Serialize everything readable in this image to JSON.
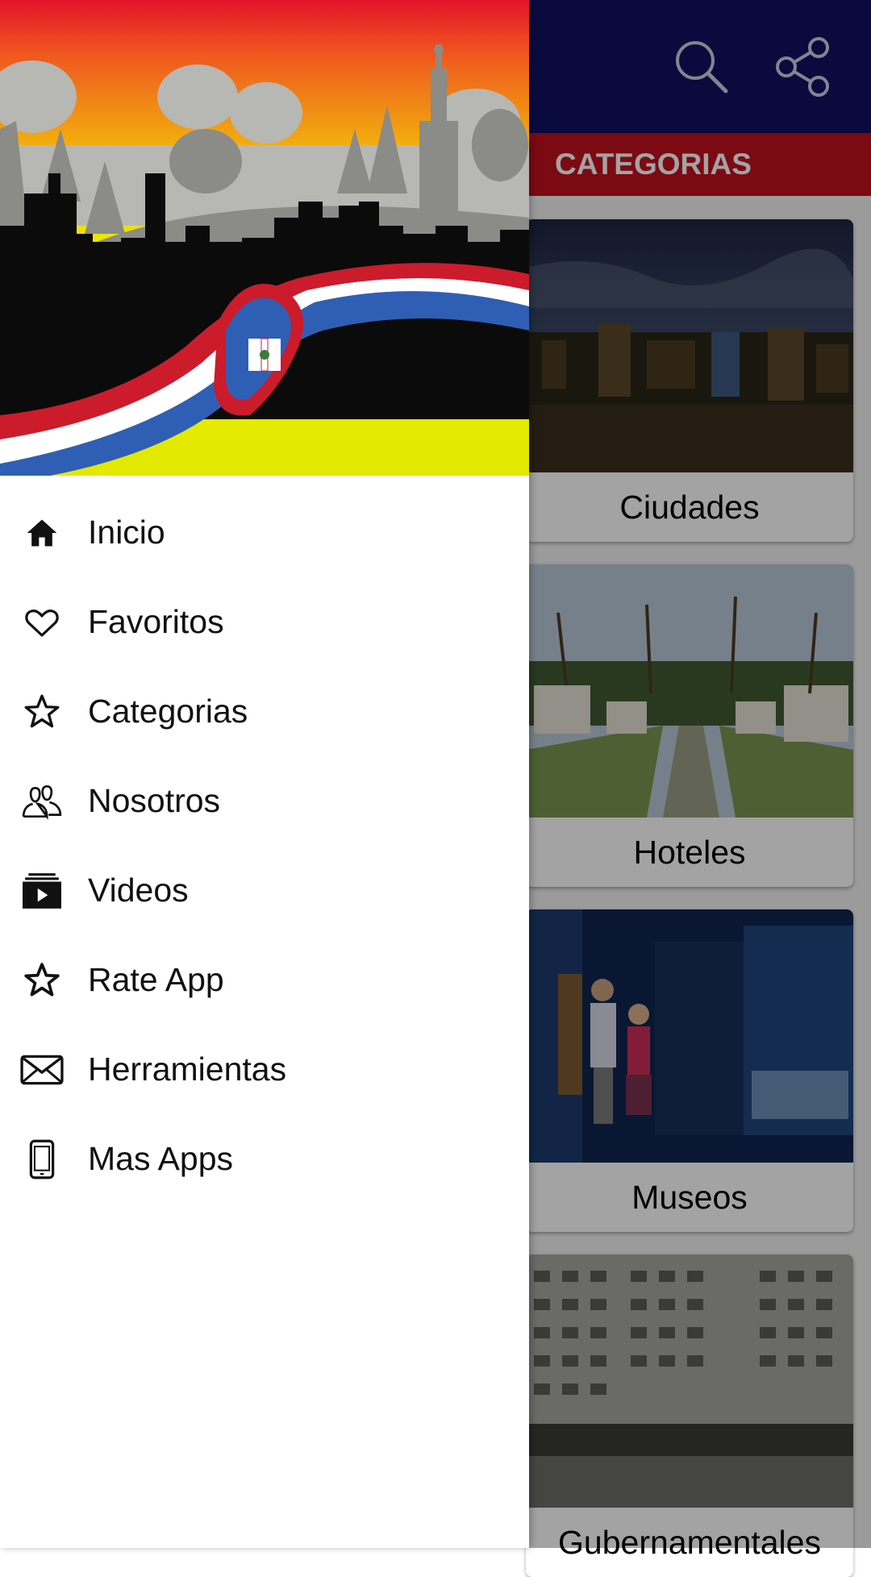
{
  "app": {
    "section_title": "CATEGORIAS",
    "icons": {
      "search": "search-icon",
      "share": "share-icon"
    },
    "colors": {
      "appbar": "#111163",
      "section": "#c0101e"
    },
    "categories": [
      {
        "label": "Ciudades"
      },
      {
        "label": "Hoteles"
      },
      {
        "label": "Museos"
      },
      {
        "label": "Gubernamentales"
      }
    ]
  },
  "drawer": {
    "menu": [
      {
        "label": "Inicio",
        "icon": "home-icon"
      },
      {
        "label": "Favoritos",
        "icon": "heart-icon"
      },
      {
        "label": "Categorias",
        "icon": "star-icon"
      },
      {
        "label": "Nosotros",
        "icon": "people-icon"
      },
      {
        "label": "Videos",
        "icon": "video-library-icon"
      },
      {
        "label": "Rate App",
        "icon": "star-icon"
      },
      {
        "label": "Herramientas",
        "icon": "envelope-icon"
      },
      {
        "label": "Mas Apps",
        "icon": "phone-icon"
      }
    ],
    "flag_colors": {
      "blue": "#2f5fb4",
      "red": "#cc1b2b",
      "white": "#ffffff"
    }
  }
}
